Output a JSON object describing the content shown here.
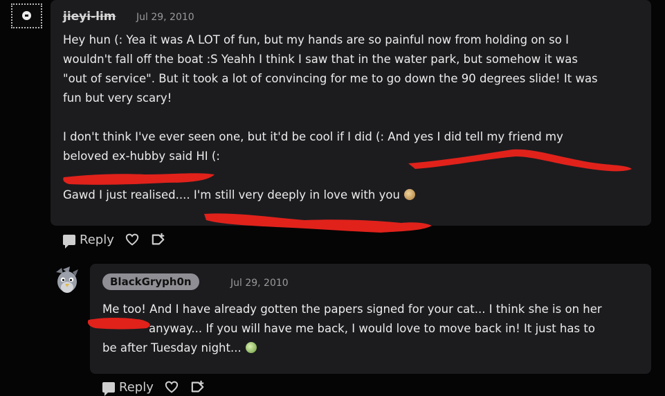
{
  "comments": [
    {
      "author": "jieyi-lim",
      "date": "Jul 29, 2010",
      "paragraphs": [
        [
          "Hey hun (: Yea it was A LOT of fun, but my hands are so painful now from holding on so I",
          "wouldn't fall off the boat :S Yeahh I think I saw that in the water park, but somehow it was",
          "\"out of service\". But it took a lot of convincing for me to go down the 90 degrees slide! It was",
          "fun but very scary!"
        ],
        [
          "I don't think I've ever seen one, but it'd be cool if I did (: And yes I did tell my friend my",
          "beloved ex-hubby said HI (:"
        ],
        [
          "Gawd I just realised.... I'm still very deeply in love with you"
        ]
      ],
      "end_emoji": "brown-smiley-emoji",
      "actions": {
        "reply_label": "Reply"
      }
    },
    {
      "author": "BlackGryph0n",
      "date": "Jul 29, 2010",
      "avatar": "gryphon-avatar",
      "lines": [
        "Me too! And I have already gotten the papers signed for your cat... I think she is on her",
        "anyway... If you will have me back, I would love to move back in! It just has to",
        "be after Tuesday night..."
      ],
      "end_emoji": "green-sad-emoji",
      "actions": {
        "reply_label": "Reply"
      }
    }
  ],
  "colors": {
    "background": "#050505",
    "card": "#1c1c1f",
    "text": "#ececec",
    "muted": "#9a9a9a",
    "name_pill": "#8e8e94",
    "redaction": "#e0221b"
  }
}
